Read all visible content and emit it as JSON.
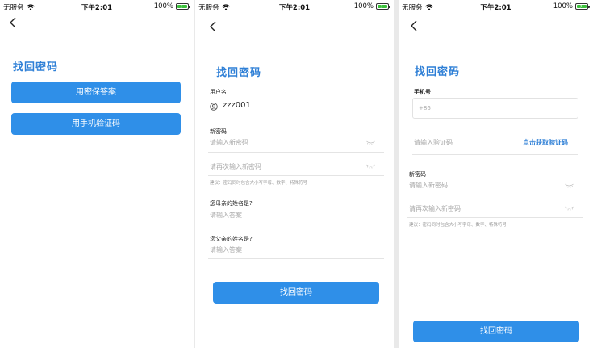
{
  "status_bar": {
    "carrier": "无服务",
    "time": "下午2:01",
    "battery": "100%"
  },
  "screen1": {
    "title": "找回密码",
    "security_question_button": "用密保答案",
    "phone_code_button": "用手机验证码"
  },
  "screen2": {
    "title": "找回密码",
    "username_label": "用户名",
    "username_value": "zzz001",
    "new_password_label": "新密码",
    "new_password_placeholder": "请输入新密码",
    "confirm_password_placeholder": "请再次输入新密码",
    "password_hint": "建议：密码同时包含大小写字母、数字、特殊符号",
    "question1_label": "您母亲的姓名是?",
    "question1_placeholder": "请输入答案",
    "question2_label": "您父亲的姓名是?",
    "question2_placeholder": "请输入答案",
    "submit_button": "找回密码"
  },
  "screen3": {
    "title": "找回密码",
    "phone_label": "手机号",
    "phone_prefix": "+86",
    "code_placeholder": "请输入验证码",
    "get_code_link": "点击获取验证码",
    "new_password_label": "新密码",
    "new_password_placeholder": "请输入新密码",
    "confirm_password_placeholder": "请再次输入新密码",
    "password_hint": "建议：密码同时包含大小写字母、数字、特殊符号",
    "submit_button": "找回密码"
  },
  "colors": {
    "accent": "#2f8fe8",
    "title": "#2e7fd6",
    "battery": "#3cc13c"
  }
}
